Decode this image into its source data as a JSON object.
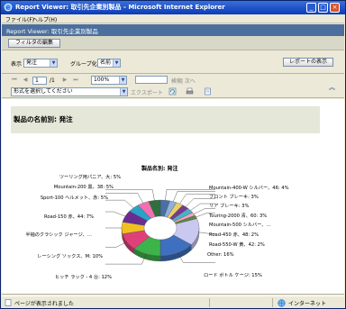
{
  "window": {
    "title": "Report Viewer: 取引先企業別製品 - Microsoft Internet Explorer",
    "menu": [
      "ファイル(F)",
      "ヘルプ(H)"
    ],
    "controls": {
      "minimize": "_",
      "maximize": "□",
      "close": "×"
    }
  },
  "report_viewer": {
    "header_title": "Report Viewer: 取引先企業別製品",
    "filter_edit_button": "フィルタの編集"
  },
  "params": {
    "display_label": "表示",
    "display_value": "発注",
    "group_label": "グループ化",
    "group_value": "名前",
    "show_report_button": "レポートの表示"
  },
  "toolbar": {
    "page_current": "1",
    "page_total": "/1",
    "zoom": "100%",
    "search_placeholder": "",
    "search_label": "検索",
    "next_label": "| 次へ",
    "format_placeholder": "形式を選択してください",
    "export_label": "エクスポート"
  },
  "report": {
    "section_title": "製品の名前別: 発注"
  },
  "chart_data": {
    "type": "pie",
    "variant": "donut-3d",
    "title": "製品名別: 発注",
    "legend": "none",
    "slices": [
      {
        "label": "Mountain-400-W シルバー、46: 4%",
        "value": 4,
        "color": "#4a6fa5"
      },
      {
        "label": "フロント ブレーキ: 3%",
        "value": 3,
        "color": "#8fb0d8"
      },
      {
        "label": "リア ブレーキ: 3%",
        "value": 3,
        "color": "#e8d06a"
      },
      {
        "label": "Touring-2000 青、60: 3%",
        "value": 3,
        "color": "#7a3a8c"
      },
      {
        "label": "Mountain-500 シルバー、…",
        "value": 3,
        "color": "#4bb0c8"
      },
      {
        "label": "Road-450 赤、48: 2%",
        "value": 2,
        "color": "#f4a3c8"
      },
      {
        "label": "Road-550-W 黄、42: 2%",
        "value": 2,
        "color": "#5a8a3c"
      },
      {
        "label": "Other: 16%",
        "value": 16,
        "color": "#c8c8f0"
      },
      {
        "label": "ロード ボトル ケージ: 15%",
        "value": 15,
        "color": "#3f6fbf"
      },
      {
        "label": "ヒッチ ラック - 4 台: 12%",
        "value": 12,
        "color": "#3cb44a"
      },
      {
        "label": "レーシング ソックス、M: 10%",
        "value": 10,
        "color": "#e0407a"
      },
      {
        "label": "半袖のクラシック ジャージ、…",
        "value": 7,
        "color": "#f0c020"
      },
      {
        "label": "Road-150 赤、44: 7%",
        "value": 7,
        "color": "#6a2c91"
      },
      {
        "label": "Sport-100 ヘルメット、赤: 5%",
        "value": 5,
        "color": "#2aa2c8"
      },
      {
        "label": "Mountain-200 黒、38: 5%",
        "value": 5,
        "color": "#f070b0"
      },
      {
        "label": "ツーリング用パニア、大: 5%",
        "value": 5,
        "color": "#2f6f3f"
      }
    ]
  },
  "status": {
    "text": "ページが表示されました",
    "zone": "インターネット"
  }
}
